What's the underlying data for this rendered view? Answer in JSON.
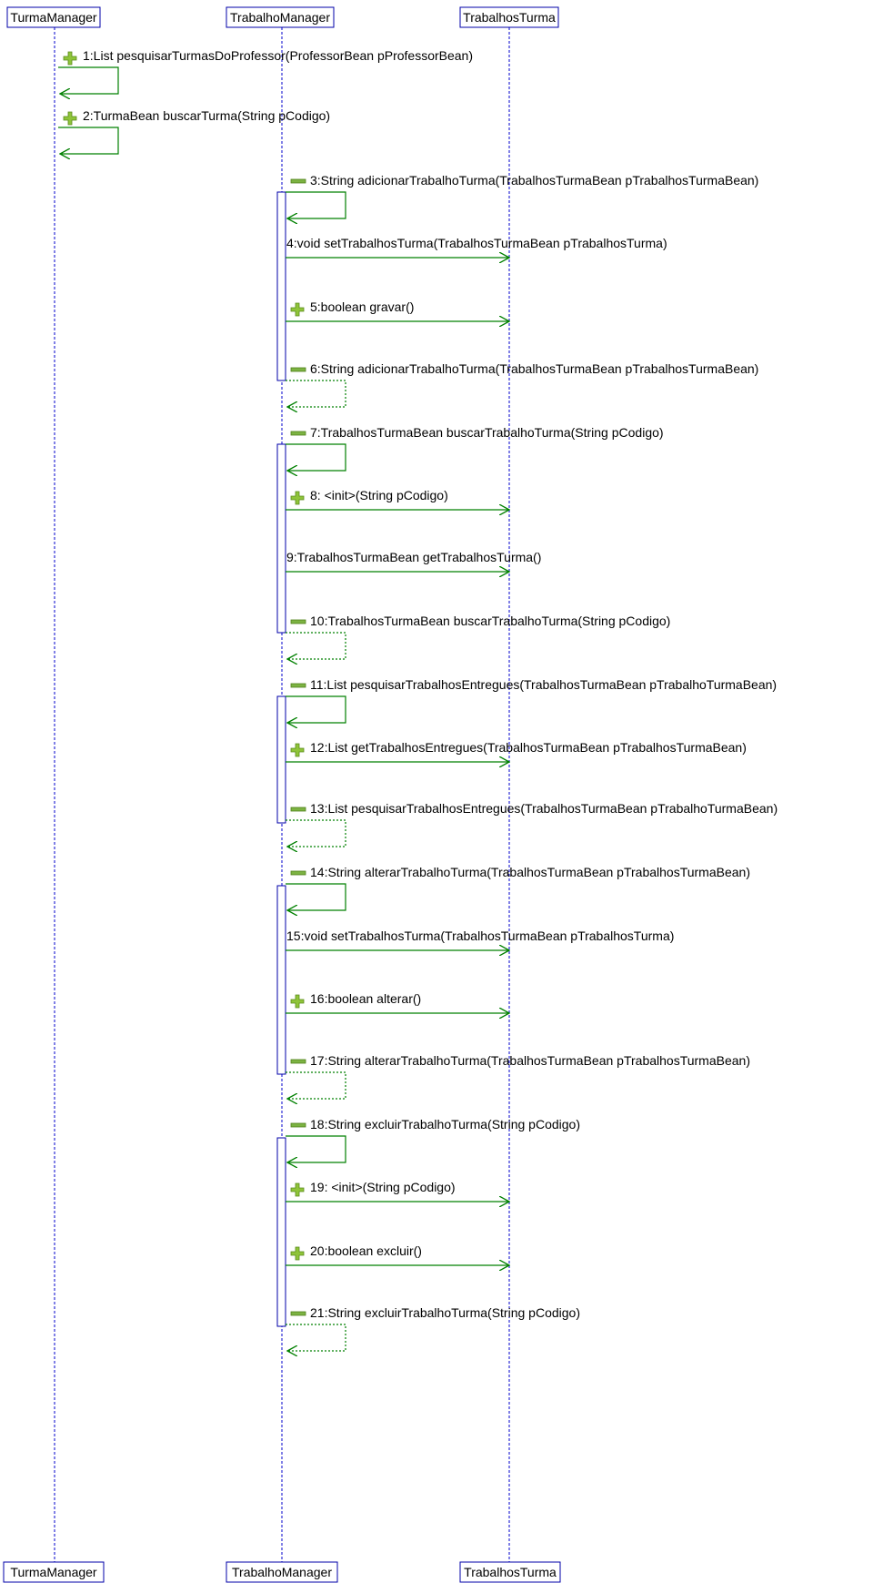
{
  "lifelines": [
    {
      "name": "TurmaManager"
    },
    {
      "name": "TrabalhoManager"
    },
    {
      "name": "TrabalhosTurma"
    }
  ],
  "messages": [
    {
      "label": "1:List pesquisarTurmasDoProfessor(ProfessorBean pProfessorBean)",
      "kind": "self",
      "icon": "plus-icon"
    },
    {
      "label": "2:TurmaBean buscarTurma(String pCodigo)",
      "kind": "self",
      "icon": "plus-icon"
    },
    {
      "label": "3:String adicionarTrabalhoTurma(TrabalhosTurmaBean pTrabalhosTurmaBean)",
      "kind": "self",
      "icon": "minus-icon"
    },
    {
      "label": "4:void setTrabalhosTurma(TrabalhosTurmaBean pTrabalhosTurma)",
      "kind": "call",
      "icon": ""
    },
    {
      "label": "5:boolean gravar()",
      "kind": "call",
      "icon": "plus-icon"
    },
    {
      "label": "6:String adicionarTrabalhoTurma(TrabalhosTurmaBean pTrabalhosTurmaBean)",
      "kind": "return",
      "icon": "minus-icon"
    },
    {
      "label": "7:TrabalhosTurmaBean buscarTrabalhoTurma(String pCodigo)",
      "kind": "self",
      "icon": "minus-icon"
    },
    {
      "label": "8: <init>(String pCodigo)",
      "kind": "call",
      "icon": "plus-icon"
    },
    {
      "label": "9:TrabalhosTurmaBean getTrabalhosTurma()",
      "kind": "call",
      "icon": ""
    },
    {
      "label": "10:TrabalhosTurmaBean buscarTrabalhoTurma(String pCodigo)",
      "kind": "return",
      "icon": "minus-icon"
    },
    {
      "label": "11:List pesquisarTrabalhosEntregues(TrabalhosTurmaBean pTrabalhoTurmaBean)",
      "kind": "self",
      "icon": "minus-icon"
    },
    {
      "label": "12:List getTrabalhosEntregues(TrabalhosTurmaBean pTrabalhosTurmaBean)",
      "kind": "call",
      "icon": "plus-icon"
    },
    {
      "label": "13:List pesquisarTrabalhosEntregues(TrabalhosTurmaBean pTrabalhoTurmaBean)",
      "kind": "return",
      "icon": "minus-icon"
    },
    {
      "label": "14:String alterarTrabalhoTurma(TrabalhosTurmaBean pTrabalhosTurmaBean)",
      "kind": "self",
      "icon": "minus-icon"
    },
    {
      "label": "15:void setTrabalhosTurma(TrabalhosTurmaBean pTrabalhosTurma)",
      "kind": "call",
      "icon": ""
    },
    {
      "label": "16:boolean alterar()",
      "kind": "call",
      "icon": "plus-icon"
    },
    {
      "label": "17:String alterarTrabalhoTurma(TrabalhosTurmaBean pTrabalhosTurmaBean)",
      "kind": "return",
      "icon": "minus-icon"
    },
    {
      "label": "18:String excluirTrabalhoTurma(String pCodigo)",
      "kind": "self",
      "icon": "minus-icon"
    },
    {
      "label": "19: <init>(String pCodigo)",
      "kind": "call",
      "icon": "plus-icon"
    },
    {
      "label": "20:boolean excluir()",
      "kind": "call",
      "icon": "plus-icon"
    },
    {
      "label": "21:String excluirTrabalhoTurma(String pCodigo)",
      "kind": "return",
      "icon": "minus-icon"
    }
  ],
  "colors": {
    "lifeline": "#0000cc",
    "message": "#008000",
    "box_border": "#0000aa",
    "plus_icon": "#8fc43a",
    "minus_icon": "#7cb342"
  }
}
